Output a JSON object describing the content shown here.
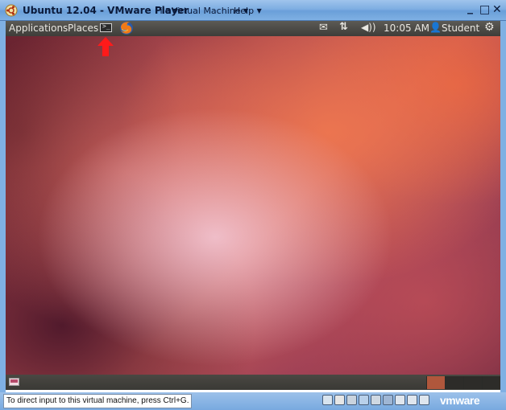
{
  "window": {
    "title": "Ubuntu 12.04 - VMware Player",
    "menus": [
      {
        "label": "File"
      },
      {
        "label": "Virtual Machine"
      },
      {
        "label": "Help"
      }
    ],
    "controls": {
      "minimize": "_",
      "maximize": "□",
      "close": "✕"
    }
  },
  "top_panel": {
    "applications": "Applications",
    "places": "Places",
    "launchers": [
      {
        "icon": "terminal-icon",
        "glyph": ">_"
      },
      {
        "icon": "firefox-icon"
      }
    ],
    "indicators": {
      "mail_icon": "✉",
      "network_icon": "⇅",
      "volume_icon": "◀))",
      "time": "10:05 AM",
      "user_icon": "👤",
      "user": "Student",
      "gear_icon": "⚙"
    }
  },
  "annotation": {
    "arrow_color": "#ff1a1a"
  },
  "bottom_panel": {
    "workspaces": [
      {
        "active": true
      },
      {
        "active": false
      },
      {
        "active": false
      },
      {
        "active": false
      }
    ]
  },
  "statusbar": {
    "message": "To direct input to this virtual machine, press Ctrl+G.",
    "logo": "vmware"
  }
}
